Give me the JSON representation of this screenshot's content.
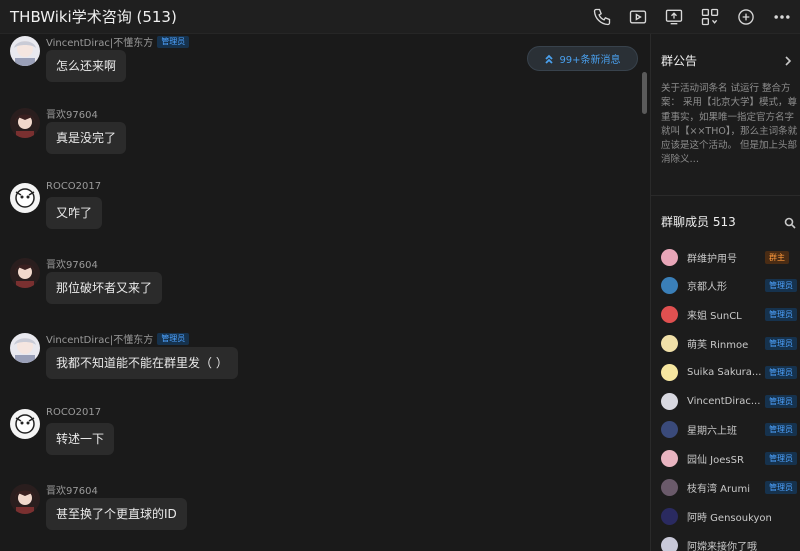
{
  "header": {
    "title": "THBWiki学术咨询 (513)",
    "tools": [
      {
        "name": "phone-icon"
      },
      {
        "name": "video-icon"
      },
      {
        "name": "screen-share-icon"
      },
      {
        "name": "apps-icon"
      },
      {
        "name": "add-icon"
      },
      {
        "name": "more-icon"
      }
    ]
  },
  "chat": {
    "new_messages_badge": "99+条新消息",
    "messages": [
      {
        "sender": "VincentDirac|不懂东方",
        "role": "管理员",
        "text": "怎么还来啊",
        "avatar": "vincent"
      },
      {
        "sender": "晋欢97604",
        "role": "",
        "text": "真是没完了",
        "avatar": "jin"
      },
      {
        "sender": "ROCO2017",
        "role": "",
        "text": "又咋了",
        "avatar": "roco"
      },
      {
        "sender": "晋欢97604",
        "role": "",
        "text": "那位破坏者又来了",
        "avatar": "jin"
      },
      {
        "sender": "VincentDirac|不懂东方",
        "role": "管理员",
        "text": "我都不知道能不能在群里发（ ）",
        "avatar": "vincent"
      },
      {
        "sender": "ROCO2017",
        "role": "",
        "text": "转述一下",
        "avatar": "roco"
      },
      {
        "sender": "晋欢97604",
        "role": "",
        "text": "甚至换了个更直球的ID",
        "avatar": "jin"
      }
    ]
  },
  "panel": {
    "notice_title": "群公告",
    "notice_text": "关于活动词条名 试运行 整合方案： 采用【北京大学】模式，尊重事实，如果唯一指定官方名字就叫【××THO】，那么主词条就应该是这个活动。 但是加上头部消除义…",
    "members_title": "群聊成员 513",
    "members": [
      {
        "name": "群维护用号",
        "role": "群主",
        "role_type": "owner",
        "color": "#e8a6b8"
      },
      {
        "name": "京都人形",
        "role": "管理员",
        "role_type": "admin",
        "color": "#3a7fb8"
      },
      {
        "name": "来姐 SunCL",
        "role": "管理员",
        "role_type": "admin",
        "color": "#e05050"
      },
      {
        "name": "萌芙 Rinmoe",
        "role": "管理员",
        "role_type": "admin",
        "color": "#f0e0a8"
      },
      {
        "name": "Suika Sakura...",
        "role": "管理员",
        "role_type": "admin",
        "color": "#f6e6a0"
      },
      {
        "name": "VincentDirac...",
        "role": "管理员",
        "role_type": "admin",
        "color": "#d8d8e0"
      },
      {
        "name": "星期六上班",
        "role": "管理员",
        "role_type": "admin",
        "color": "#3a4a7a"
      },
      {
        "name": "园仙 JoesSR",
        "role": "管理员",
        "role_type": "admin",
        "color": "#e8b4c0"
      },
      {
        "name": "枝有湾 Arumi",
        "role": "管理员",
        "role_type": "admin",
        "color": "#6a5a6a"
      },
      {
        "name": "阿時 Gensoukyonob...",
        "role": "",
        "role_type": "",
        "color": "#2a2a60"
      },
      {
        "name": "阿嫦来接你了哦",
        "role": "",
        "role_type": "",
        "color": "#c8c8d8"
      }
    ]
  },
  "colors": {
    "background": "#1a1a1a",
    "bubble": "#2b2b2b",
    "accent": "#4aa0ee",
    "owner": "#ff9a3c"
  }
}
